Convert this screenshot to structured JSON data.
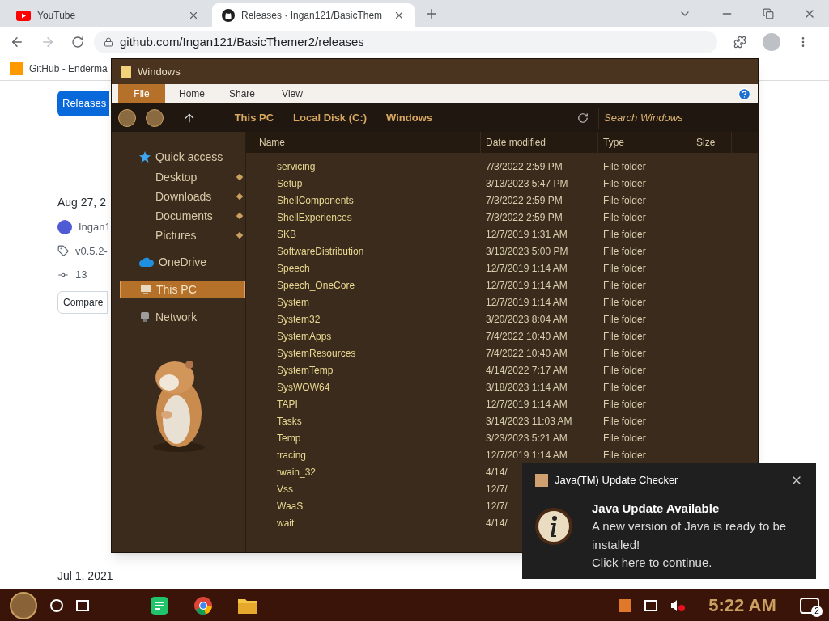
{
  "browser": {
    "tabs": [
      {
        "label": "YouTube",
        "selected": false
      },
      {
        "label": "Releases · Ingan121/BasicThem",
        "selected": true
      }
    ],
    "url": "github.com/Ingan121/BasicThemer2/releases",
    "bookmarks": [
      {
        "label": "GitHub - Enderma"
      }
    ]
  },
  "page": {
    "releases_button": "Releases",
    "date": "Aug 27, 2",
    "author": "Ingan1",
    "tag": "v0.5.2-",
    "commit": "13",
    "compare": "Compare",
    "date_2": "Jul 1, 2021"
  },
  "explorer": {
    "title": "Windows",
    "ribbon_tabs": [
      {
        "label": "File",
        "selected": true
      },
      {
        "label": "Home",
        "selected": false
      },
      {
        "label": "Share",
        "selected": false
      },
      {
        "label": "View",
        "selected": false
      }
    ],
    "breadcrumb": [
      "This PC",
      "Local Disk (C:)",
      "Windows"
    ],
    "search": {
      "placeholder": "Search Windows"
    },
    "nav": [
      {
        "label": "Quick access",
        "kind": "star",
        "selected": false,
        "children": [
          {
            "label": "Desktop",
            "pinned": true
          },
          {
            "label": "Downloads",
            "pinned": true
          },
          {
            "label": "Documents",
            "pinned": true
          },
          {
            "label": "Pictures",
            "pinned": true
          }
        ]
      },
      {
        "label": "OneDrive",
        "kind": "cloud",
        "selected": false
      },
      {
        "label": "This PC",
        "kind": "pc",
        "selected": true
      },
      {
        "label": "Network",
        "kind": "network",
        "selected": false
      }
    ],
    "columns": [
      "Name",
      "Date modified",
      "Type",
      "Size"
    ],
    "rows": [
      {
        "name": "servicing",
        "date": "7/3/2022 2:59 PM",
        "type": "File folder"
      },
      {
        "name": "Setup",
        "date": "3/13/2023 5:47 PM",
        "type": "File folder"
      },
      {
        "name": "ShellComponents",
        "date": "7/3/2022 2:59 PM",
        "type": "File folder"
      },
      {
        "name": "ShellExperiences",
        "date": "7/3/2022 2:59 PM",
        "type": "File folder"
      },
      {
        "name": "SKB",
        "date": "12/7/2019 1:31 AM",
        "type": "File folder"
      },
      {
        "name": "SoftwareDistribution",
        "date": "3/13/2023 5:00 PM",
        "type": "File folder"
      },
      {
        "name": "Speech",
        "date": "12/7/2019 1:14 AM",
        "type": "File folder"
      },
      {
        "name": "Speech_OneCore",
        "date": "12/7/2019 1:14 AM",
        "type": "File folder"
      },
      {
        "name": "System",
        "date": "12/7/2019 1:14 AM",
        "type": "File folder"
      },
      {
        "name": "System32",
        "date": "3/20/2023 8:04 AM",
        "type": "File folder"
      },
      {
        "name": "SystemApps",
        "date": "7/4/2022 10:40 AM",
        "type": "File folder"
      },
      {
        "name": "SystemResources",
        "date": "7/4/2022 10:40 AM",
        "type": "File folder"
      },
      {
        "name": "SystemTemp",
        "date": "4/14/2022 7:17 AM",
        "type": "File folder"
      },
      {
        "name": "SysWOW64",
        "date": "3/18/2023 1:14 AM",
        "type": "File folder"
      },
      {
        "name": "TAPI",
        "date": "12/7/2019 1:14 AM",
        "type": "File folder"
      },
      {
        "name": "Tasks",
        "date": "3/14/2023 11:03 AM",
        "type": "File folder"
      },
      {
        "name": "Temp",
        "date": "3/23/2023 5:21 AM",
        "type": "File folder"
      },
      {
        "name": "tracing",
        "date": "12/7/2019 1:14 AM",
        "type": "File folder"
      },
      {
        "name": "twain_32",
        "date": "4/14/"
      },
      {
        "name": "Vss",
        "date": "12/7/"
      },
      {
        "name": "WaaS",
        "date": "12/7/"
      },
      {
        "name": "wait",
        "date": "4/14/"
      }
    ]
  },
  "toast": {
    "app": "Java(TM) Update Checker",
    "title": "Java Update Available",
    "body": "A new version of Java is ready to be installed!",
    "action": "Click here to continue."
  },
  "taskbar": {
    "apps": [
      {
        "kind": "notes"
      },
      {
        "kind": "chrome"
      },
      {
        "kind": "folder"
      }
    ],
    "time": "5:22 AM",
    "notifications": "2",
    "muted": true
  }
}
